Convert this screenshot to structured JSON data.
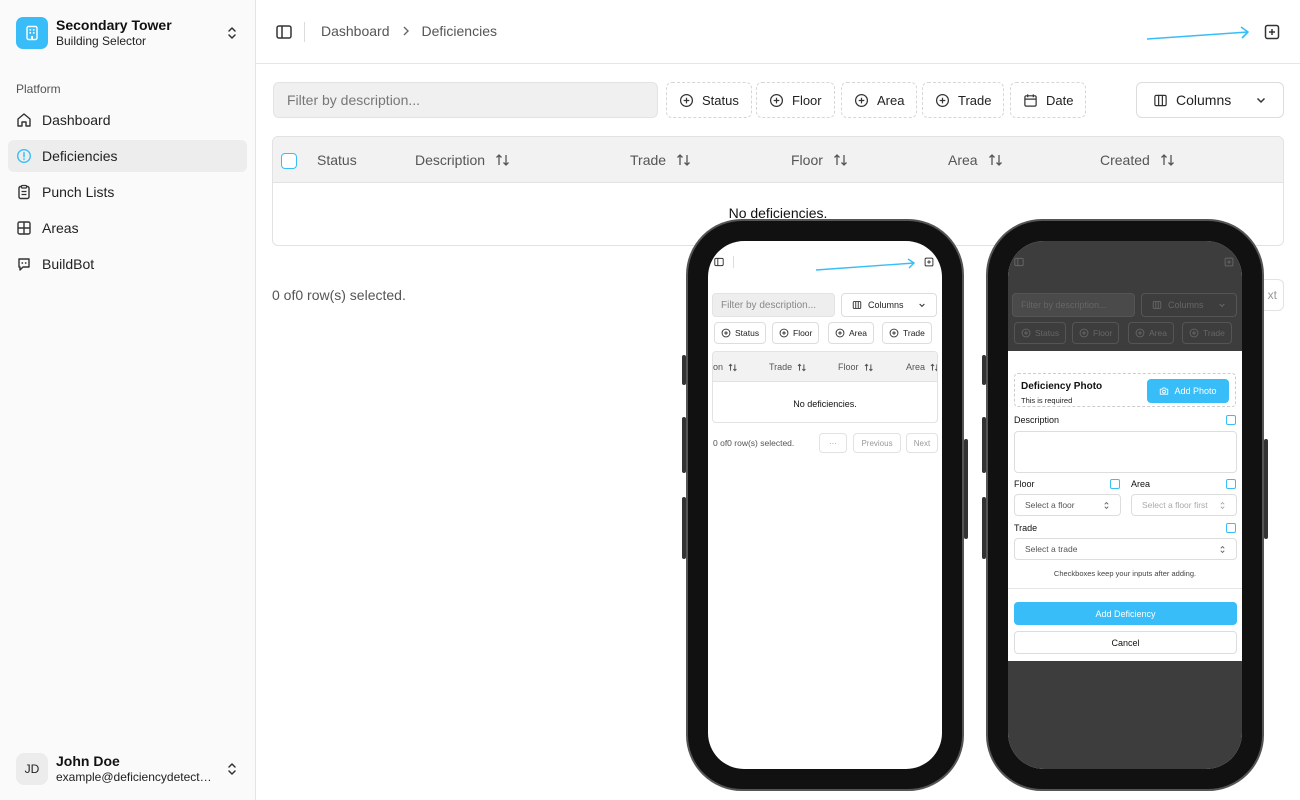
{
  "sidebar": {
    "building": {
      "name": "Secondary Tower",
      "subtitle": "Building Selector"
    },
    "section_label": "Platform",
    "items": [
      {
        "label": "Dashboard",
        "icon": "home-icon"
      },
      {
        "label": "Deficiencies",
        "icon": "alert-circle-icon",
        "active": true
      },
      {
        "label": "Punch Lists",
        "icon": "clipboard-icon"
      },
      {
        "label": "Areas",
        "icon": "layout-grid-icon"
      },
      {
        "label": "BuildBot",
        "icon": "bot-message-icon"
      }
    ],
    "user": {
      "initials": "JD",
      "name": "John Doe",
      "email": "example@deficiencydetect...."
    }
  },
  "header": {
    "breadcrumb": [
      "Dashboard",
      "Deficiencies"
    ]
  },
  "toolbar": {
    "filter_placeholder": "Filter by description...",
    "chips": [
      "Status",
      "Floor",
      "Area",
      "Trade",
      "Date"
    ],
    "columns_label": "Columns"
  },
  "table": {
    "columns": [
      "Status",
      "Description",
      "Trade",
      "Floor",
      "Area",
      "Created"
    ],
    "empty_text": "No deficiencies.",
    "selection_text": "0 of0 row(s) selected.",
    "next_partial": "xt"
  },
  "phone1": {
    "filter_placeholder": "Filter by description...",
    "columns_label": "Columns",
    "chips": [
      "Status",
      "Floor",
      "Area",
      "Trade"
    ],
    "columns": [
      "on",
      "Trade",
      "Floor",
      "Area"
    ],
    "empty_text": "No deficiencies.",
    "selection_text": "0 of0 row(s) selected.",
    "more_label": "···",
    "previous_label": "Previous",
    "next_label": "Next"
  },
  "phone2": {
    "bg": {
      "filter_placeholder": "Filter by description...",
      "columns_label": "Columns",
      "chips": [
        "Status",
        "Floor",
        "Area",
        "Trade"
      ]
    },
    "form": {
      "photo_title": "Deficiency Photo",
      "photo_required": "This is required",
      "add_photo_label": "Add Photo",
      "description_label": "Description",
      "floor_label": "Floor",
      "area_label": "Area",
      "floor_placeholder": "Select a floor",
      "area_placeholder": "Select a floor first",
      "trade_label": "Trade",
      "trade_placeholder": "Select a trade",
      "note": "Checkboxes keep your inputs after adding.",
      "submit_label": "Add Deficiency",
      "cancel_label": "Cancel"
    }
  },
  "colors": {
    "accent": "#38bdf8",
    "arrow": "#38bdf8"
  }
}
